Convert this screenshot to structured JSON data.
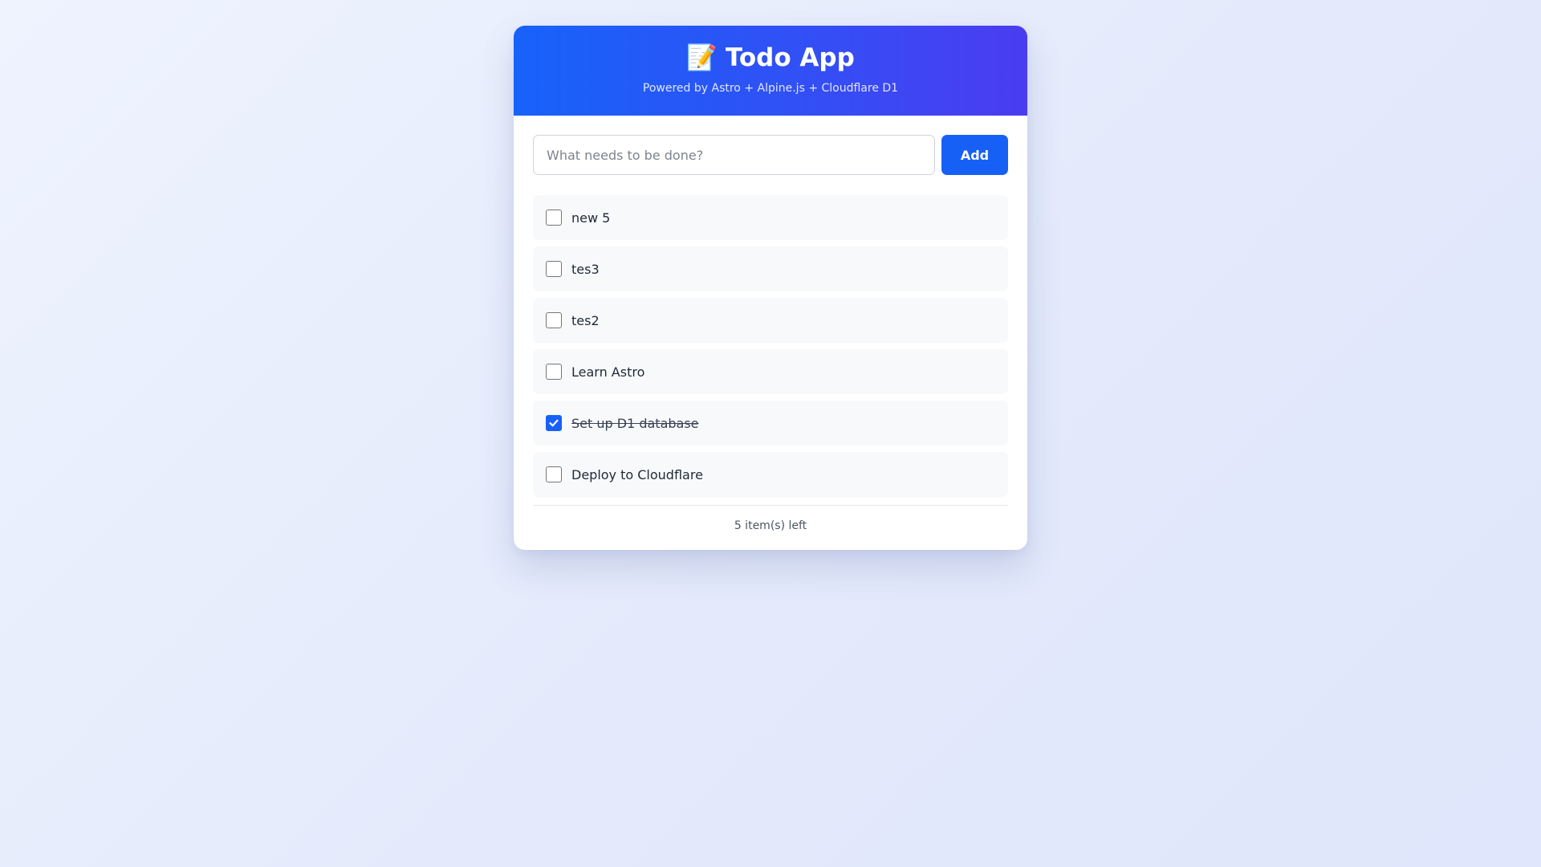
{
  "header": {
    "emoji": "📝",
    "title": "Todo App",
    "subtitle": "Powered by Astro + Alpine.js + Cloudflare D1"
  },
  "new_todo": {
    "value": "",
    "placeholder": "What needs to be done?",
    "add_label": "Add"
  },
  "todos": [
    {
      "text": "new 5",
      "done": false
    },
    {
      "text": "tes3",
      "done": false
    },
    {
      "text": "tes2",
      "done": false
    },
    {
      "text": "Learn Astro",
      "done": false
    },
    {
      "text": "Set up D1 database",
      "done": true
    },
    {
      "text": "Deploy to Cloudflare",
      "done": false
    }
  ],
  "footer": {
    "items_left": "5 item(s) left"
  },
  "colors": {
    "accent": "#1760f6",
    "header_gradient_start": "#1762fa",
    "header_gradient_end": "#4b3cf0"
  },
  "icons": {
    "title_icon": "memo-emoji",
    "checkbox_checked": "check-icon"
  }
}
